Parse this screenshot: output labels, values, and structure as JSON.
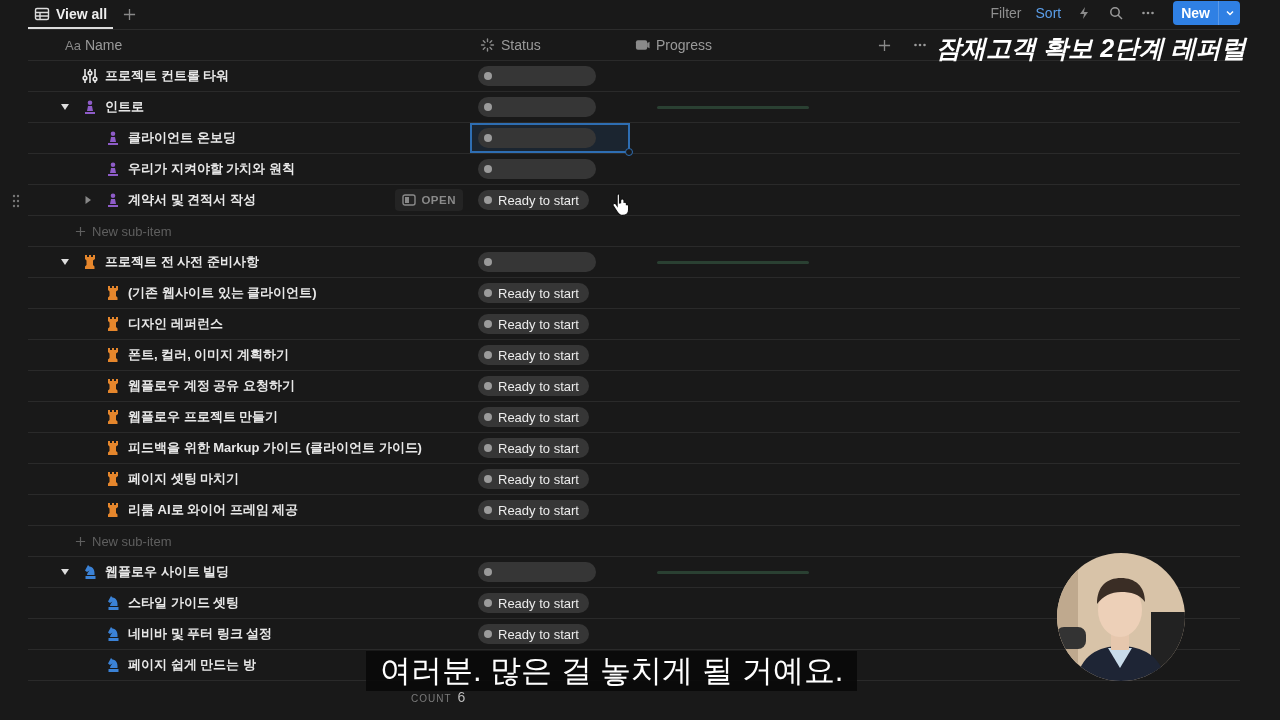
{
  "tabs": [
    {
      "label": "View all",
      "selected": true
    }
  ],
  "toolbar": {
    "filter": "Filter",
    "sort": "Sort",
    "sort_active": true,
    "new_button": "New"
  },
  "overlay_title": "잠재고객 확보 2단계 레퍼럴",
  "columns": [
    {
      "label": "Name",
      "kind": "name",
      "icon_text": "Aa"
    },
    {
      "label": "Status",
      "kind": "status"
    },
    {
      "label": "Progress",
      "kind": "progress"
    }
  ],
  "rows": [
    {
      "name": "프로젝트 컨트롤 타워",
      "kind": "sliders",
      "color": "#e8e8e8",
      "status_pill": true,
      "selected": false
    },
    {
      "name": "인트로",
      "kind": "pawn",
      "color": "#8e5cc8",
      "expanded": true,
      "status_pill": true,
      "selected": false,
      "progress_bar": true,
      "new_sub_item": "New sub-item",
      "children": [
        {
          "name": "클라이언트 온보딩",
          "kind": "pawn",
          "color": "#8e5cc8",
          "status_pill": true,
          "selected": true
        },
        {
          "name": "우리가 지켜야할 가치와 원칙",
          "kind": "pawn",
          "color": "#8e5cc8",
          "status_pill": true,
          "selected": false
        },
        {
          "name": "계약서 및 견적서 작성",
          "kind": "pawn",
          "color": "#8e5cc8",
          "expanded": false,
          "hovered": true,
          "open_button": "OPEN",
          "status_pill": true,
          "status": "Ready to start",
          "selected": false
        }
      ]
    },
    {
      "name": "프로젝트 전 사전 준비사항",
      "kind": "rook",
      "color": "#e5862c",
      "expanded": true,
      "status_pill": true,
      "selected": false,
      "progress_bar": true,
      "new_sub_item": "New sub-item",
      "children": [
        {
          "name": "(기존 웹사이트 있는 클라이언트)",
          "kind": "rook",
          "color": "#e5862c",
          "status_pill": true,
          "status": "Ready to start",
          "selected": false
        },
        {
          "name": "디자인 레퍼런스",
          "kind": "rook",
          "color": "#e5862c",
          "status_pill": true,
          "status": "Ready to start",
          "selected": false
        },
        {
          "name": "폰트, 컬러, 이미지 계획하기",
          "kind": "rook",
          "color": "#e5862c",
          "status_pill": true,
          "status": "Ready to start",
          "selected": false
        },
        {
          "name": "웹플로우 계정 공유 요청하기",
          "kind": "rook",
          "color": "#e5862c",
          "status_pill": true,
          "status": "Ready to start",
          "selected": false
        },
        {
          "name": "웹플로우 프로젝트 만들기",
          "kind": "rook",
          "color": "#e5862c",
          "status_pill": true,
          "status": "Ready to start",
          "selected": false
        },
        {
          "name": "피드백을 위한  Markup 가이드  (클라이언트 가이드)",
          "kind": "rook",
          "color": "#e5862c",
          "status_pill": true,
          "status": "Ready to start",
          "selected": false
        },
        {
          "name": "페이지 셋팅 마치기",
          "kind": "rook",
          "color": "#e5862c",
          "status_pill": true,
          "status": "Ready to start",
          "selected": false
        },
        {
          "name": "리룸 AI로 와이어 프레임 제공",
          "kind": "rook",
          "color": "#e5862c",
          "status_pill": true,
          "status": "Ready to start",
          "selected": false
        }
      ]
    },
    {
      "name": "웹플로우 사이트 빌딩",
      "kind": "knight",
      "color": "#3b82d6",
      "expanded": true,
      "status_pill": true,
      "selected": false,
      "progress_bar": true,
      "children": [
        {
          "name": "스타일 가이드 셋팅",
          "kind": "knight",
          "color": "#3b82d6",
          "status_pill": true,
          "status": "Ready to start",
          "selected": false
        },
        {
          "name": "네비바 및 푸터 링크 설정",
          "kind": "knight",
          "color": "#3b82d6",
          "status_pill": true,
          "status": "Ready to start",
          "selected": false
        },
        {
          "name": "페이지 쉽게 만드는 방",
          "kind": "knight",
          "color": "#3b82d6",
          "status_pill": false,
          "selected": false
        }
      ]
    }
  ],
  "count": {
    "label": "COUNT",
    "value": "6"
  },
  "subtitle": "여러분. 많은 걸 놓치게 될 거예요."
}
